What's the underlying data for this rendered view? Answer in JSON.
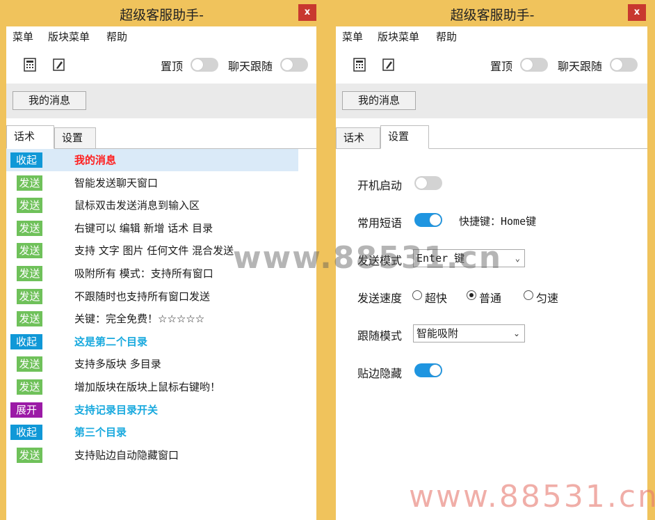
{
  "left_window": {
    "title": "超级客服助手-",
    "close_label": "x",
    "menu": [
      "菜单",
      "版块菜单",
      "帮助"
    ],
    "toolbar": {
      "pin_label": "置顶",
      "pin_on": false,
      "follow_label": "聊天跟随",
      "follow_on": false
    },
    "my_messages_button": "我的消息",
    "tabs": [
      "话术",
      "设置"
    ],
    "active_tab": "话术",
    "rows": [
      {
        "badge": "收起",
        "badge_type": "collapse",
        "text": "我的消息",
        "style": "red"
      },
      {
        "badge": "发送",
        "badge_type": "send",
        "text": "智能发送聊天窗口",
        "style": "normal"
      },
      {
        "badge": "发送",
        "badge_type": "send",
        "text": "鼠标双击发送消息到输入区",
        "style": "normal"
      },
      {
        "badge": "发送",
        "badge_type": "send",
        "text": "右键可以 编辑 新增 话术 目录",
        "style": "normal"
      },
      {
        "badge": "发送",
        "badge_type": "send",
        "text": "支持 文字 图片 任何文件 混合发送",
        "style": "normal"
      },
      {
        "badge": "发送",
        "badge_type": "send",
        "text": "吸附所有 模式：支持所有窗口",
        "style": "normal"
      },
      {
        "badge": "发送",
        "badge_type": "send",
        "text": "不跟随时也支持所有窗口发送",
        "style": "normal"
      },
      {
        "badge": "发送",
        "badge_type": "send",
        "text": "关键：完全免费！☆☆☆☆☆",
        "style": "normal"
      },
      {
        "badge": "收起",
        "badge_type": "collapse",
        "text": "这是第二个目录",
        "style": "blue"
      },
      {
        "badge": "发送",
        "badge_type": "send",
        "text": "支持多版块 多目录",
        "style": "normal"
      },
      {
        "badge": "发送",
        "badge_type": "send",
        "text": "增加版块在版块上鼠标右键哟！",
        "style": "normal"
      },
      {
        "badge": "展开",
        "badge_type": "expand",
        "text": "支持记录目录开关",
        "style": "blue"
      },
      {
        "badge": "收起",
        "badge_type": "collapse",
        "text": "第三个目录",
        "style": "blue"
      },
      {
        "badge": "发送",
        "badge_type": "send",
        "text": "支持贴边自动隐藏窗口",
        "style": "normal"
      }
    ]
  },
  "right_window": {
    "title": "超级客服助手-",
    "close_label": "x",
    "menu": [
      "菜单",
      "版块菜单",
      "帮助"
    ],
    "toolbar": {
      "pin_label": "置顶",
      "pin_on": false,
      "follow_label": "聊天跟随",
      "follow_on": false
    },
    "my_messages_button": "我的消息",
    "tabs": [
      "话术",
      "设置"
    ],
    "active_tab": "设置",
    "settings": {
      "startup_label": "开机启动",
      "startup_on": false,
      "phrases_label": "常用短语",
      "phrases_on": true,
      "hotkey_text": "快捷键：Home键",
      "send_mode_label": "发送模式",
      "send_mode_value": "Enter 键",
      "send_speed_label": "发送速度",
      "speed_options": [
        "超快",
        "普通",
        "匀速"
      ],
      "speed_selected": "普通",
      "follow_mode_label": "跟随模式",
      "follow_mode_value": "智能吸附",
      "edge_hide_label": "贴边隐藏",
      "edge_hide_on": true
    }
  },
  "watermarks": [
    "www.88531.cn",
    "www.88531.cn"
  ],
  "colors": {
    "frame": "#f0c35c",
    "close": "#c8382f",
    "send_badge": "#6fc15a",
    "collapse_badge": "#1098d7",
    "expand_badge": "#9b1aa6",
    "toggle_on": "#1f95e0",
    "red_text": "#ff1e1e",
    "blue_text": "#18a9de"
  }
}
